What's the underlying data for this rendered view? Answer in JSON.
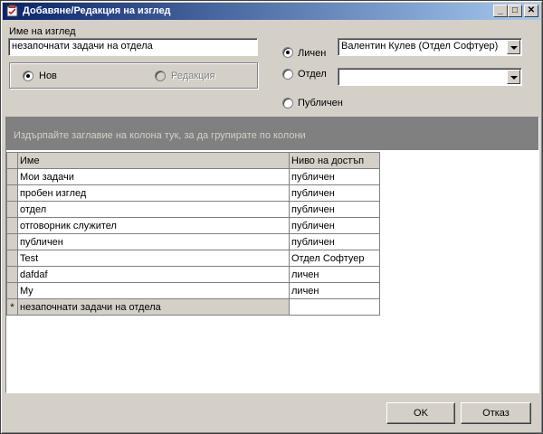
{
  "window": {
    "title": "Добавяне/Редакция на изглед",
    "controls": {
      "minimize": "_",
      "maximize": "□",
      "close": "✕"
    }
  },
  "form": {
    "view_name_label": "Име на изглед",
    "view_name_value": "незапочнати задачи на отдела",
    "mode": {
      "new_label": "Нов",
      "edit_label": "Редакция",
      "selected": "new"
    },
    "access": {
      "personal_label": "Личен",
      "department_label": "Отдел",
      "public_label": "Публичен",
      "selected": "personal",
      "personal_combo_value": "Валентин Кулев (Отдел Софтуер)",
      "department_combo_value": ""
    }
  },
  "grid": {
    "group_panel_hint": "Издърпайте заглавие на колона тук, за да групирате по колони",
    "columns": [
      "Име",
      "Ниво на достъп"
    ],
    "rows": [
      [
        "Мои задачи",
        "публичен"
      ],
      [
        "пробен изглед",
        "публичен"
      ],
      [
        "отдел",
        "публичен"
      ],
      [
        "отговорник служител",
        "публичен"
      ],
      [
        "публичен",
        "публичен"
      ],
      [
        "Test",
        "Отдел Софтуер"
      ],
      [
        "dafdaf",
        "личен"
      ],
      [
        "My",
        "личен"
      ]
    ],
    "new_row": {
      "indicator": "*",
      "name": "незапочнати задачи на отдела",
      "access": ""
    }
  },
  "buttons": {
    "ok": "OK",
    "cancel": "Отказ"
  },
  "colors": {
    "titlebar_start": "#0a246a",
    "titlebar_end": "#a6caf0",
    "face": "#d4d0c8"
  }
}
